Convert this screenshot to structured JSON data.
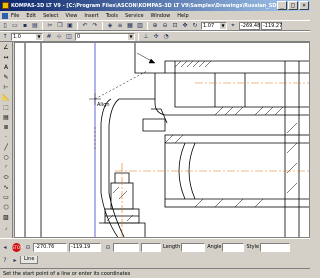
{
  "window": {
    "title": "KOMPAS-3D LT V9 - [C:\\Program Files\\ASCON\\KOMPAS-3D LT V9\\Samples\\Drawings\\Russian_SDST\\SAMPLE12.CDW]",
    "minimize": "_",
    "maximize": "□",
    "close": "×"
  },
  "menu": {
    "items": [
      "File",
      "Edit",
      "Select",
      "View",
      "Insert",
      "Tools",
      "Service",
      "Window",
      "Help"
    ]
  },
  "toolbar1": {
    "zoom_value": "1.07",
    "coord_x": "-269.48",
    "coord_y": "-119.27"
  },
  "toolbar2": {
    "step_value": "1.0",
    "layer_value": "0"
  },
  "canvas": {
    "cursor_hint": "Align"
  },
  "propbar": {
    "point_x": "-270.76",
    "point_y": "-119.19",
    "length_label": "Length",
    "angle_label": "Angle",
    "style_label": "Style",
    "tab_label": "Line"
  },
  "status": {
    "text": "Set the start point of a line or enter its coordinates"
  }
}
